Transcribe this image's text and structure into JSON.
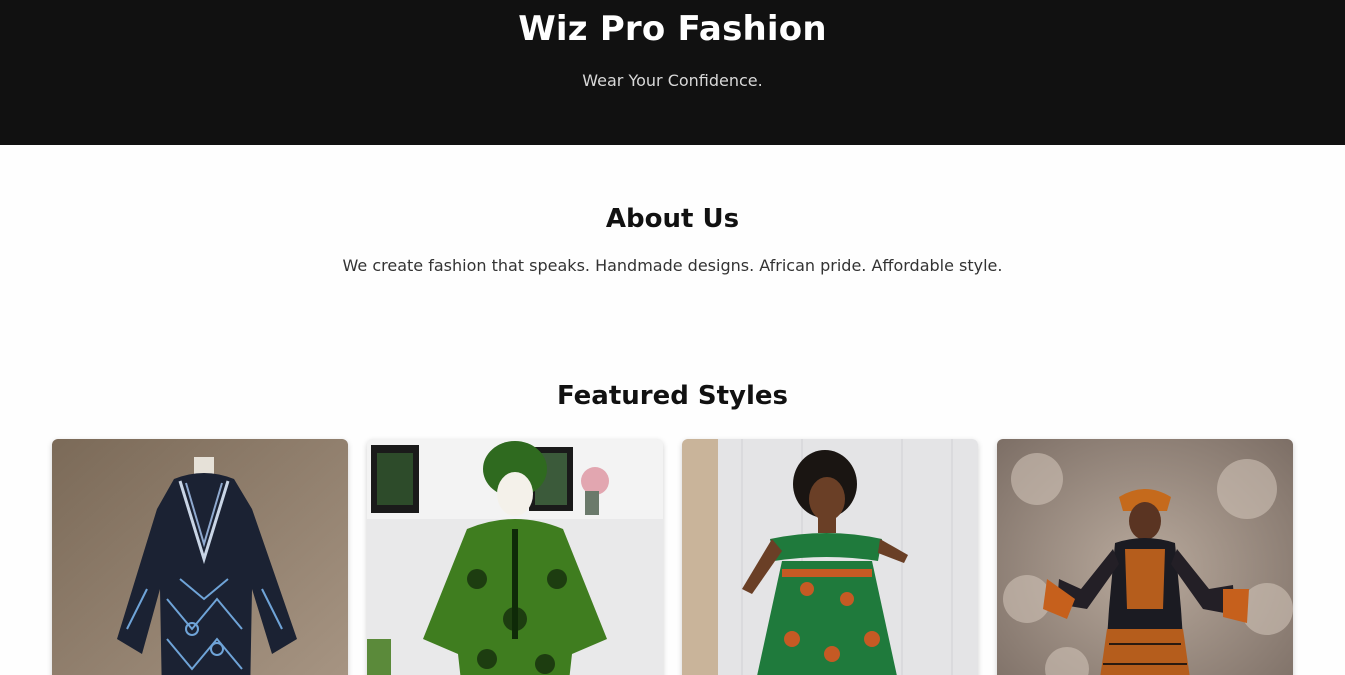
{
  "hero": {
    "title": "Wiz Pro Fashion",
    "tagline": "Wear Your Confidence."
  },
  "about": {
    "heading": "About Us",
    "text": "We create fashion that speaks. Handmade designs. African pride. Affordable style."
  },
  "featured": {
    "heading": "Featured Styles",
    "cards": [
      {
        "image": "navy-blue-tie-dye-tunic-on-mannequin"
      },
      {
        "image": "green-ankara-dress-with-headwrap-on-mannequin"
      },
      {
        "image": "woman-in-green-off-shoulder-ankara-dress"
      },
      {
        "image": "woman-in-orange-ankara-lace-gown-with-headwrap"
      }
    ]
  },
  "colors": {
    "header_bg": "#111111",
    "page_bg": "#fefefe",
    "text": "#111111"
  }
}
